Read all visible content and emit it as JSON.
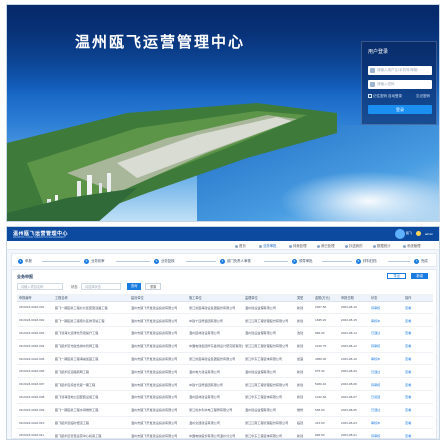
{
  "login": {
    "title": "温州瓯飞运营管理中心",
    "panel_title": "用户登录",
    "username_placeholder": "请输入用户名/手机号/邮箱",
    "password_placeholder": "请输入密码",
    "remember_label": "记住密码 自动登录",
    "forgot_label": "忘记密码",
    "login_button": "登录"
  },
  "app": {
    "brand": "温州瓯飞运营管理中心",
    "brand_en": "WENZHOU OUFEI OPERATION MANAGEMENT",
    "logo_text": "瓯飞",
    "user": "admin",
    "tabs": [
      "首页",
      "业务审批",
      "待我处理",
      "我已处理",
      "抄送我的",
      "数据统计",
      "系统管理"
    ],
    "active_tab": 1,
    "steps": [
      "申报",
      "业务初审",
      "业务复核",
      "部门负责人审核",
      "领导审批",
      "材料归档",
      "完成"
    ],
    "panel_title": "业务申报",
    "add_button": "导出",
    "new_button": "新增",
    "filters": {
      "keyword_placeholder": "请输入项目名称",
      "status_label": "状态",
      "status_value": "请选择状态",
      "search_button": "查询",
      "reset_button": "重置"
    },
    "table": {
      "headers": [
        "申报编号",
        "工程名称",
        "建设单位",
        "施工单位",
        "监理单位",
        "类型",
        "金额(万元)",
        "申报日期",
        "状态",
        "操作"
      ],
      "rows": [
        [
          "OF2023-0018-001",
          "瓯飞一期围垦工程北片区配套道路工程",
          "温州市瓯飞开发建设投资有限公司",
          "浙江省围海建设集团股份有限公司",
          "温州建设监理有限公司",
          "新建",
          "2367.50",
          "2023-08-16",
          "待审核",
          "查看"
        ],
        [
          "OF2023-0018-002",
          "瓯飞一期围垦工程南片区排涝站工程",
          "温州市瓯飞开发建设投资有限公司",
          "中铁十四局集团有限公司",
          "浙江江南工程管理股份有限公司",
          "新建",
          "1845.20",
          "2023-08-15",
          "审核中",
          "查看"
        ],
        [
          "OF2023-0018-003",
          "瓯飞滨海大道绿化景观提升工程",
          "温州市瓯飞开发建设投资有限公司",
          "温州园林建设有限公司",
          "温州建设监理有限公司",
          "改建",
          "986.00",
          "2023-08-14",
          "已通过",
          "查看"
        ],
        [
          "OF2023-0018-004",
          "瓯飞起步区市政给排水管网工程",
          "温州市瓯飞开发建设投资有限公司",
          "中国电建集团华东勘测设计研究院有限公司",
          "浙江江南工程管理股份有限公司",
          "新建",
          "3120.75",
          "2023-08-12",
          "待审核",
          "查看"
        ],
        [
          "OF2023-0018-005",
          "瓯飞一期围垦工程海堤加固工程",
          "温州市瓯飞开发建设投资有限公司",
          "浙江省围海建设集团股份有限公司",
          "浙江华东工程咨询有限公司",
          "加固",
          "4580.00",
          "2023-08-10",
          "审核中",
          "查看"
        ],
        [
          "OF2023-0018-006",
          "瓯飞起步区道路照明工程",
          "温州市瓯飞开发建设投资有限公司",
          "温州电力建设有限公司",
          "温州建设监理有限公司",
          "新建",
          "675.30",
          "2023-08-09",
          "已通过",
          "查看"
        ],
        [
          "OF2023-0018-007",
          "瓯飞起步区综合管廊一期工程",
          "温州市瓯飞开发建设投资有限公司",
          "中铁十四局集团有限公司",
          "浙江江南工程管理股份有限公司",
          "新建",
          "5260.40",
          "2023-08-08",
          "待审核",
          "查看"
        ],
        [
          "OF2023-0018-008",
          "瓯飞滨海湿地公园配套设施工程",
          "温州市瓯飞开发建设投资有限公司",
          "温州园林建设有限公司",
          "浙江华东工程咨询有限公司",
          "新建",
          "1432.60",
          "2023-08-07",
          "已驳回",
          "查看"
        ],
        [
          "OF2023-0018-009",
          "瓯飞一期围垦工程水闸维修工程",
          "温州市瓯飞开发建设投资有限公司",
          "浙江省水利水电工程局有限公司",
          "温州建设监理有限公司",
          "维修",
          "538.90",
          "2023-08-05",
          "已通过",
          "查看"
        ],
        [
          "OF2023-0018-010",
          "瓯飞起步区临时便道工程",
          "温州市瓯飞开发建设投资有限公司",
          "温州交通建设有限公司",
          "浙江江南工程管理股份有限公司",
          "临建",
          "312.00",
          "2023-08-03",
          "审核中",
          "查看"
        ],
        [
          "OF2023-0018-011",
          "瓯飞起步区智慧运营中心机房工程",
          "温州市瓯飞开发建设投资有限公司",
          "中国电信股份有限公司温州分公司",
          "浙江华东工程咨询有限公司",
          "新建",
          "896.50",
          "2023-08-01",
          "待审核",
          "查看"
        ]
      ]
    }
  }
}
